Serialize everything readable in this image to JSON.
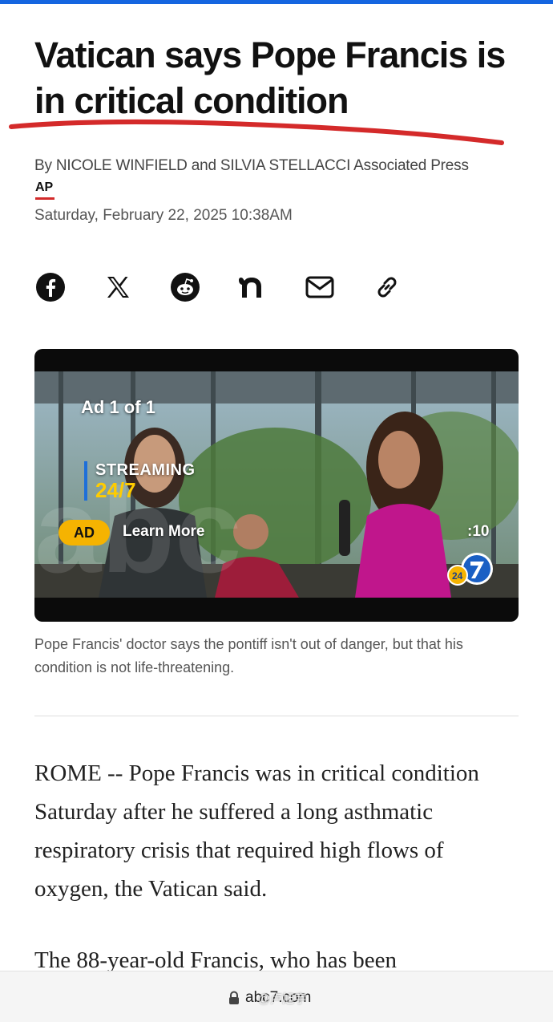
{
  "article": {
    "headline": "Vatican says Pope Francis is in critical condition",
    "byline": "By NICOLE WINFIELD and SILVIA STELLACCI Associated Press",
    "source_logo": "AP",
    "date": "Saturday, February 22, 2025 10:38AM"
  },
  "share": [
    {
      "icon": "facebook-icon"
    },
    {
      "icon": "x-icon"
    },
    {
      "icon": "reddit-icon"
    },
    {
      "icon": "nextdoor-icon"
    },
    {
      "icon": "email-icon"
    },
    {
      "icon": "link-icon"
    }
  ],
  "video": {
    "ad_counter": "Ad 1 of 1",
    "streaming_label": "STREAMING",
    "streaming_sub": "24/7",
    "ad_badge": "AD",
    "learn_more": "Learn More",
    "timer": ":10",
    "caption": "Pope Francis' doctor says the pontiff isn't out of danger, but that his condition is not life-threatening."
  },
  "body": {
    "p1": "ROME -- Pope Francis was in critical condition Saturday after he suffered a long asthmatic respiratory crisis that required high flows of oxygen, the Vatican said.",
    "p2": "The 88-year-old Francis, who has been"
  },
  "browser": {
    "url": "abc7.com"
  },
  "overlay": {
    "watermark": "@卢旭宇"
  },
  "colors": {
    "accent_top_bar": "#1565e0",
    "underline_annotation": "#d42a2a",
    "ad_badge": "#f5b301"
  }
}
